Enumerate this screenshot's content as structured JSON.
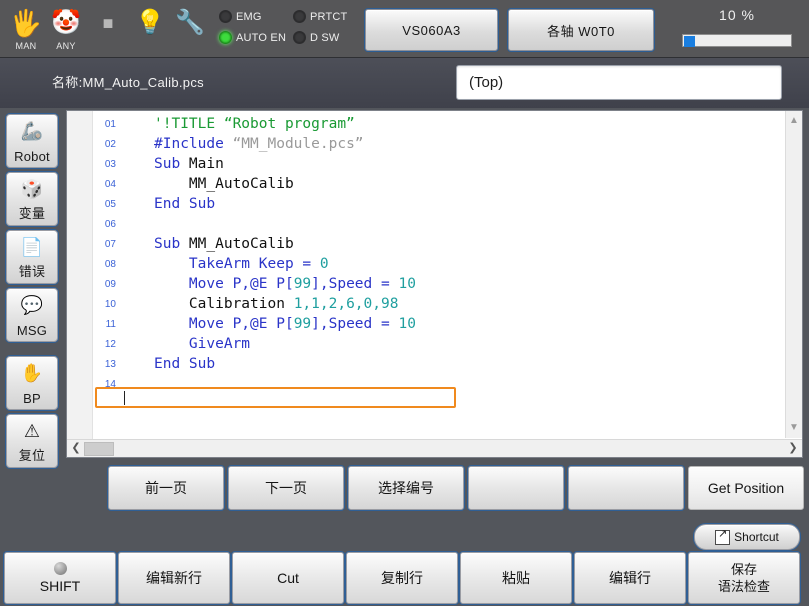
{
  "statusbar": {
    "icons": [
      {
        "name": "hand-icon",
        "glyph": "🖐",
        "label": "MAN",
        "color": "#f2c66a"
      },
      {
        "name": "clown-icon",
        "glyph": "🤡",
        "label": "ANY",
        "color": "#f0f0f0"
      },
      {
        "name": "stop-square-icon",
        "glyph": "■",
        "label": "",
        "color": "#b8b8b8"
      },
      {
        "name": "lightbulb-icon",
        "glyph": "💡",
        "label": "",
        "color": "#f4e58a"
      },
      {
        "name": "wrench-warning-icon",
        "glyph": "🔧",
        "label": "",
        "color": "#c9c9c9"
      }
    ],
    "leds": [
      {
        "name": "led-emg",
        "label": "EMG",
        "state": "off"
      },
      {
        "name": "led-prtct",
        "label": "PRTCT",
        "state": "off"
      },
      {
        "name": "led-auto-en",
        "label": "AUTO EN",
        "state": "on"
      },
      {
        "name": "led-dsw",
        "label": "D SW",
        "state": "off"
      }
    ],
    "model_button": "VS060A3",
    "axis_button": "各轴 W0T0",
    "speed_value": "10 %",
    "speed_percent": 10,
    "colors": {
      "led_on": "#3ddb3d",
      "progress": "#1a7ee0",
      "accent_orange": "#f08a1e"
    }
  },
  "namebar": {
    "program_label": "名称:MM_Auto_Calib.pcs",
    "scope_field": "(Top)"
  },
  "sidebar": {
    "items": [
      {
        "name": "sidebar-item-robot",
        "label": "Robot",
        "icon": "robot-arm-icon",
        "glyph": "🦾"
      },
      {
        "name": "sidebar-item-variable",
        "label": "变量",
        "icon": "dice-variable-icon",
        "glyph": "🎲"
      },
      {
        "name": "sidebar-item-error",
        "label": "错误",
        "icon": "document-check-icon",
        "glyph": "📄"
      },
      {
        "name": "sidebar-item-msg",
        "label": "MSG",
        "icon": "speech-bubble-icon",
        "glyph": "💬"
      },
      {
        "name": "sidebar-item-bp",
        "label": "BP",
        "icon": "hand-stop-icon",
        "glyph": "✋"
      },
      {
        "name": "sidebar-item-reset",
        "label": "复位",
        "icon": "warning-triangle-icon",
        "glyph": "⚠"
      }
    ]
  },
  "editor": {
    "current_line": 9,
    "caret_line": 9,
    "lines": [
      {
        "no": "01",
        "segs": [
          {
            "t": "'!TITLE “Robot program”",
            "c": "cm"
          }
        ]
      },
      {
        "no": "02",
        "segs": [
          {
            "t": "#Include ",
            "c": "kw"
          },
          {
            "t": "“MM_Module.pcs”",
            "c": "st"
          }
        ]
      },
      {
        "no": "03",
        "segs": [
          {
            "t": "Sub ",
            "c": "kw"
          },
          {
            "t": "Main",
            "c": "pl"
          }
        ]
      },
      {
        "no": "04",
        "segs": [
          {
            "t": "    MM_AutoCalib",
            "c": "pl"
          }
        ]
      },
      {
        "no": "05",
        "segs": [
          {
            "t": "End Sub",
            "c": "kw"
          }
        ]
      },
      {
        "no": "06",
        "segs": [
          {
            "t": "",
            "c": "pl"
          }
        ]
      },
      {
        "no": "07",
        "segs": [
          {
            "t": "Sub ",
            "c": "kw"
          },
          {
            "t": "MM_AutoCalib",
            "c": "pl"
          }
        ]
      },
      {
        "no": "08",
        "segs": [
          {
            "t": "    ",
            "c": "pl"
          },
          {
            "t": "TakeArm Keep = ",
            "c": "kw"
          },
          {
            "t": "0",
            "c": "num"
          }
        ]
      },
      {
        "no": "09",
        "segs": [
          {
            "t": "    ",
            "c": "pl"
          },
          {
            "t": "Move P,@E P[",
            "c": "kw"
          },
          {
            "t": "99",
            "c": "num"
          },
          {
            "t": "],Speed = ",
            "c": "kw"
          },
          {
            "t": "10",
            "c": "num"
          }
        ]
      },
      {
        "no": "10",
        "segs": [
          {
            "t": "    Calibration ",
            "c": "pl"
          },
          {
            "t": "1,1,2,6,0,98",
            "c": "num"
          }
        ]
      },
      {
        "no": "11",
        "segs": [
          {
            "t": "    ",
            "c": "pl"
          },
          {
            "t": "Move P,@E P[",
            "c": "kw"
          },
          {
            "t": "99",
            "c": "num"
          },
          {
            "t": "],Speed = ",
            "c": "kw"
          },
          {
            "t": "10",
            "c": "num"
          }
        ]
      },
      {
        "no": "12",
        "segs": [
          {
            "t": "    ",
            "c": "pl"
          },
          {
            "t": "GiveArm",
            "c": "kw"
          }
        ]
      },
      {
        "no": "13",
        "segs": [
          {
            "t": "End Sub",
            "c": "kw"
          }
        ]
      },
      {
        "no": "14",
        "segs": [
          {
            "t": "",
            "c": "pl"
          }
        ]
      }
    ],
    "scroll": {
      "v_up_icon": "chevron-up-icon",
      "v_down_icon": "chevron-down-icon",
      "h_left_icon": "chevron-left-icon",
      "h_right_icon": "chevron-right-icon"
    }
  },
  "function_row": [
    {
      "name": "fn-prev-page",
      "label": "前一页"
    },
    {
      "name": "fn-next-page",
      "label": "下一页"
    },
    {
      "name": "fn-select-number",
      "label": "选择编号"
    },
    {
      "name": "fn-blank-4",
      "label": ""
    },
    {
      "name": "fn-blank-5",
      "label": ""
    },
    {
      "name": "fn-get-position",
      "label": "Get Position"
    }
  ],
  "shortcut": {
    "label": "Shortcut",
    "icon": "shortcut-arrow-icon"
  },
  "bottom_row": [
    {
      "name": "shift-button",
      "label": "SHIFT",
      "line2": ""
    },
    {
      "name": "edit-new-line-button",
      "label": "编辑新行",
      "line2": ""
    },
    {
      "name": "cut-button",
      "label": "Cut",
      "line2": ""
    },
    {
      "name": "copy-line-button",
      "label": "复制行",
      "line2": ""
    },
    {
      "name": "paste-button",
      "label": "粘贴",
      "line2": ""
    },
    {
      "name": "edit-line-button",
      "label": "编辑行",
      "line2": ""
    },
    {
      "name": "save-syntax-check-button",
      "label": "保存",
      "line2": "语法检查"
    }
  ]
}
